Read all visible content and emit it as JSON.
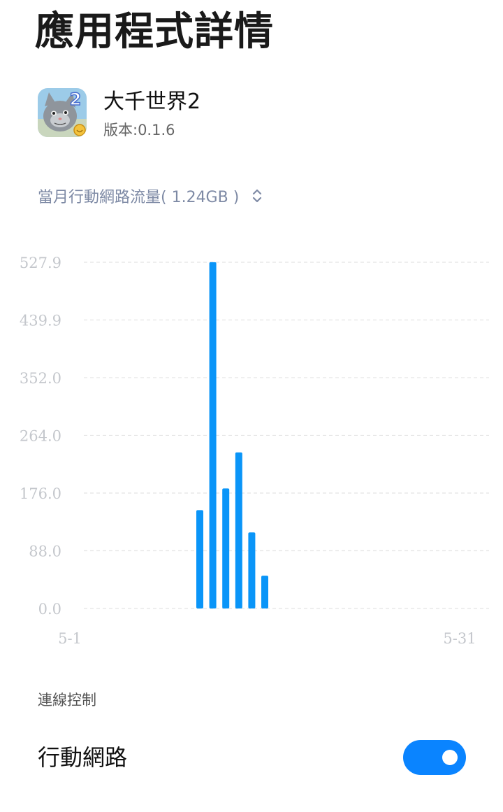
{
  "page": {
    "title": "應用程式詳情"
  },
  "app": {
    "name": "大千世界2",
    "version": "版本:0.1.6"
  },
  "data_usage": {
    "label": "當月行動網路流量( 1.24GB )"
  },
  "chart_data": {
    "type": "bar",
    "title": "",
    "xlabel": "",
    "ylabel": "",
    "y_ticks": [
      "0.0",
      "88.0",
      "176.0",
      "264.0",
      "352.0",
      "439.9",
      "527.9"
    ],
    "ylim": [
      0,
      527.9
    ],
    "x_tick_labels": [
      "5-1",
      "5-31"
    ],
    "x_range": [
      1,
      31
    ],
    "bar_color": "#0a95f8",
    "grid": true,
    "points": [
      {
        "x": 11,
        "y": 150
      },
      {
        "x": 12,
        "y": 528
      },
      {
        "x": 13,
        "y": 183
      },
      {
        "x": 14,
        "y": 238
      },
      {
        "x": 15,
        "y": 116
      },
      {
        "x": 16,
        "y": 50
      }
    ]
  },
  "connection": {
    "section_label": "連線控制",
    "mobile_network_label": "行動網路",
    "mobile_network_enabled": true,
    "toggle_color": "#0a84ff"
  }
}
